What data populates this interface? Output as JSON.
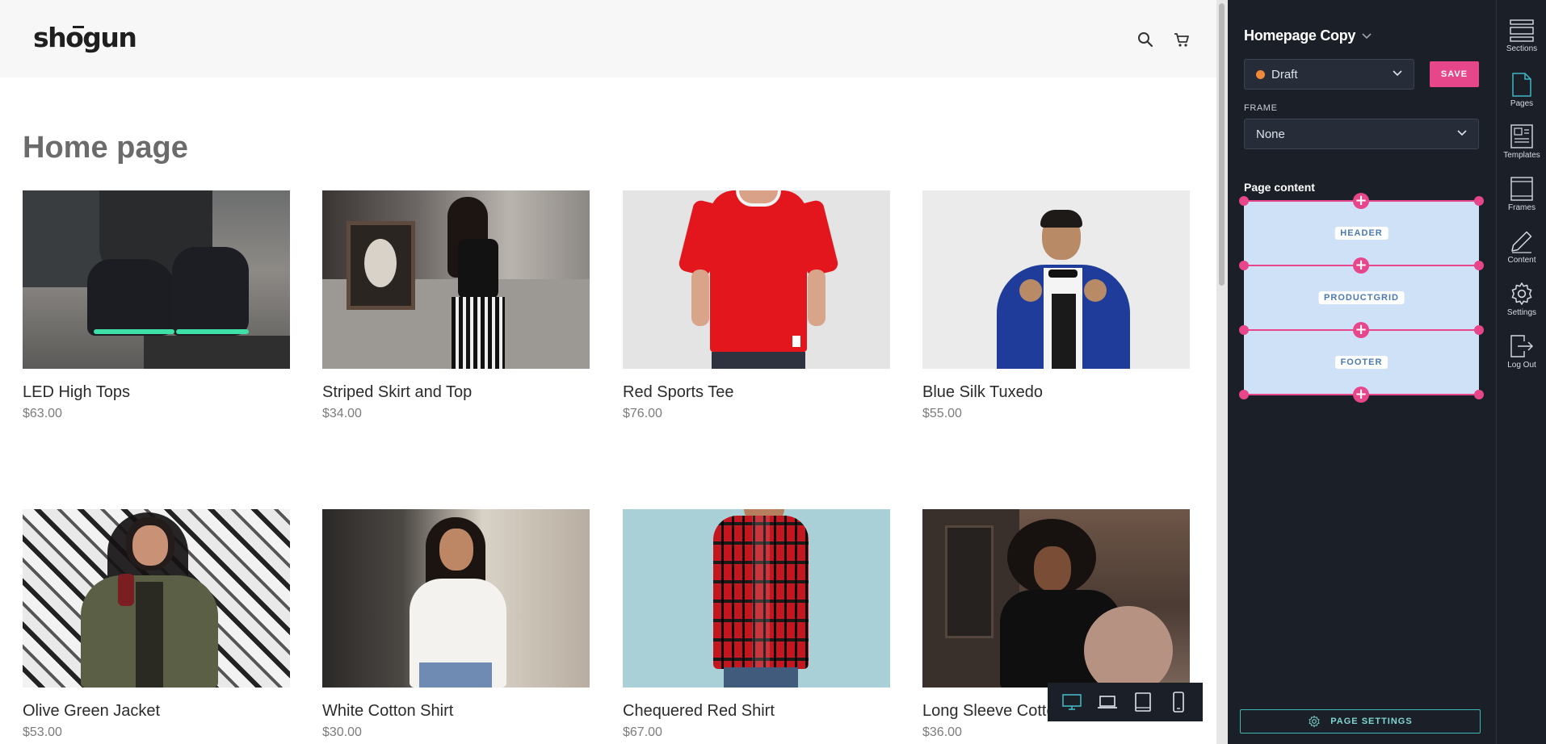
{
  "store": {
    "logo": "shogun",
    "page_title": "Home page",
    "products": [
      {
        "name": "LED High Tops",
        "price": "$63.00"
      },
      {
        "name": "Striped Skirt and Top",
        "price": "$34.00"
      },
      {
        "name": "Red Sports Tee",
        "price": "$76.00"
      },
      {
        "name": "Blue Silk Tuxedo",
        "price": "$55.00"
      },
      {
        "name": "Olive Green Jacket",
        "price": "$53.00"
      },
      {
        "name": "White Cotton Shirt",
        "price": "$30.00"
      },
      {
        "name": "Chequered Red Shirt",
        "price": "$67.00"
      },
      {
        "name": "Long Sleeve Cotton",
        "price": "$36.00"
      }
    ]
  },
  "editor": {
    "page_name": "Homepage Copy",
    "status": "Draft",
    "status_color": "#f08a3a",
    "save_label": "SAVE",
    "frame_label": "FRAME",
    "frame_value": "None",
    "content_label": "Page content",
    "sections": [
      "HEADER",
      "PRODUCTGRID",
      "FOOTER"
    ],
    "page_settings_label": "PAGE SETTINGS",
    "accent_color": "#e8468a"
  },
  "rail": [
    "Sections",
    "Pages",
    "Templates",
    "Frames",
    "Content",
    "Settings",
    "Log Out"
  ],
  "device_modes": [
    "desktop-icon",
    "laptop-icon",
    "tablet-icon",
    "mobile-icon"
  ]
}
